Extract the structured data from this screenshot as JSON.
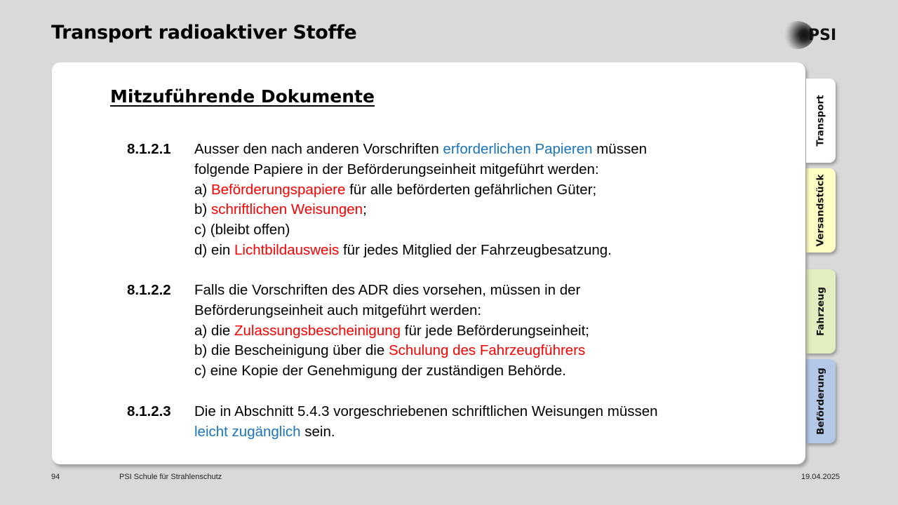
{
  "slide": {
    "title": "Transport radioaktiver Stoffe",
    "logo_text": "PSI"
  },
  "card": {
    "heading": "Mitzuführende Dokumente",
    "paragraphs": [
      {
        "number": "8.1.2.1",
        "lines": [
          [
            {
              "text": "Ausser den nach anderen Vorschriften "
            },
            {
              "text": "erforderlichen Papieren",
              "color": "blue"
            },
            {
              "text": " müssen"
            }
          ],
          [
            {
              "text": "folgende Papiere in der Beförderungseinheit mitgeführt werden:"
            }
          ],
          [
            {
              "text": "a) "
            },
            {
              "text": "Beförderungspapiere",
              "color": "red"
            },
            {
              "text": " für alle beförderten gefährlichen Güter;"
            }
          ],
          [
            {
              "text": "b) "
            },
            {
              "text": "schriftlichen Weisungen",
              "color": "red"
            },
            {
              "text": ";"
            }
          ],
          [
            {
              "text": "c) (bleibt offen)"
            }
          ],
          [
            {
              "text": "d) ein "
            },
            {
              "text": "Lichtbildausweis",
              "color": "red"
            },
            {
              "text": " für jedes Mitglied der Fahrzeugbesatzung."
            }
          ]
        ]
      },
      {
        "number": "8.1.2.2",
        "lines": [
          [
            {
              "text": "Falls die Vorschriften des ADR dies vorsehen, müssen in der"
            }
          ],
          [
            {
              "text": "Beförderungseinheit auch mitgeführt werden:"
            }
          ],
          [
            {
              "text": "a) die "
            },
            {
              "text": "Zulassungsbescheinigung",
              "color": "red"
            },
            {
              "text": " für jede Beförderungseinheit;"
            }
          ],
          [
            {
              "text": "b) die Bescheinigung über die "
            },
            {
              "text": "Schulung des Fahrzeugführers",
              "color": "red"
            }
          ],
          [
            {
              "text": "c) eine Kopie der Genehmigung der zuständigen Behörde."
            }
          ]
        ]
      },
      {
        "number": "8.1.2.3",
        "lines": [
          [
            {
              "text": "Die in Abschnitt 5.4.3 vorgeschriebenen schriftlichen Weisungen müssen"
            }
          ],
          [
            {
              "text": "leicht zugänglich",
              "color": "blue"
            },
            {
              "text": " sein."
            }
          ]
        ]
      }
    ]
  },
  "tabs": [
    {
      "label": "Transport"
    },
    {
      "label": "Versandstück"
    },
    {
      "label": "Fahrzeug"
    },
    {
      "label": "Beförderung"
    }
  ],
  "footer": {
    "page": "94",
    "organization": "PSI Schule für Strahlenschutz",
    "date": "19.04.2025"
  },
  "colors": {
    "blue": "#1a75bc",
    "red": "#ff0000"
  }
}
